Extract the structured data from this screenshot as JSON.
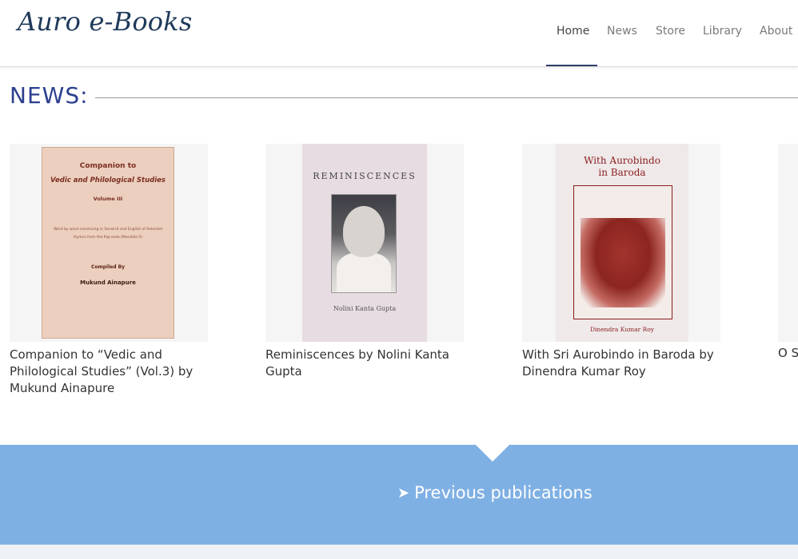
{
  "header": {
    "logo": "Auro e-Books",
    "nav": [
      {
        "label": "Home",
        "active": true
      },
      {
        "label": "News",
        "active": false
      },
      {
        "label": "Store",
        "active": false
      },
      {
        "label": "Library",
        "active": false
      },
      {
        "label": "About",
        "active": false
      }
    ]
  },
  "news": {
    "heading": "NEWS:",
    "cards": [
      {
        "title": "Companion to “Vedic and Philological Studies” (Vol.3) by Mukund Ainapure",
        "cover": {
          "line1": "Companion to",
          "line2": "Vedic and Philological Studies",
          "volume": "Volume III",
          "subtitle": "Word by word construing in Sanskrit and English of Selected Hymns from the Rig-veda (Mandala 5)",
          "compiled_by": "Compiled By",
          "author": "Mukund Ainapure"
        }
      },
      {
        "title": "Reminiscences by Nolini Kanta Gupta",
        "cover": {
          "title": "REMINISCENCES",
          "author": "Nolini Kanta Gupta"
        }
      },
      {
        "title": "With Sri Aurobindo in Baroda by Dinendra Kumar Roy",
        "cover": {
          "title": "With Aurobindo in Baroda",
          "author": "Dinendra Kumar Roy"
        }
      },
      {
        "title": "O S"
      }
    ]
  },
  "banner": {
    "link_icon": "arrow-right-icon",
    "link_label": "Previous publications",
    "color": "#7fb0e4"
  }
}
